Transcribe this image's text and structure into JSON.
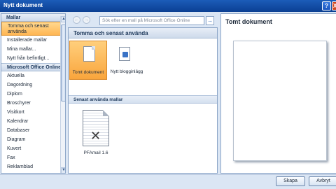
{
  "window": {
    "title": "Nytt dokument",
    "help_glyph": "?",
    "close_glyph": "X"
  },
  "sidebar": {
    "header": "Mallar",
    "items": [
      {
        "label_line1": "Tomma och senast",
        "label_line2": "använda",
        "selected": true
      },
      {
        "label": "Installerade mallar"
      },
      {
        "label": "Mina mallar..."
      },
      {
        "label": "Nytt från befintligt..."
      }
    ],
    "section_header": "Microsoft Office Online",
    "online_items": [
      "Aktuella",
      "Dagordning",
      "Diplom",
      "Broschyrer",
      "Visitkort",
      "Kalendrar",
      "Databaser",
      "Diagram",
      "Kuvert",
      "Fax",
      "Reklamblad"
    ],
    "scroll_up": "▲",
    "scroll_down": "▼"
  },
  "nav": {
    "back_glyph": "←",
    "forward_glyph": "→",
    "search_placeholder": "Sök efter en mall på Microsoft Office Online",
    "search_go_glyph": "→"
  },
  "main": {
    "header": "Tomma och senast använda",
    "tiles": [
      {
        "label": "Tomt dokument",
        "selected": true
      },
      {
        "label": "Nytt blogginlägg"
      }
    ],
    "recent_header": "Senast använda mallar",
    "recent": [
      {
        "label": "PFAmail 1.6"
      }
    ]
  },
  "preview": {
    "title": "Tomt dokument"
  },
  "footer": {
    "create_label": "Skapa",
    "cancel_label": "Avbryt"
  }
}
